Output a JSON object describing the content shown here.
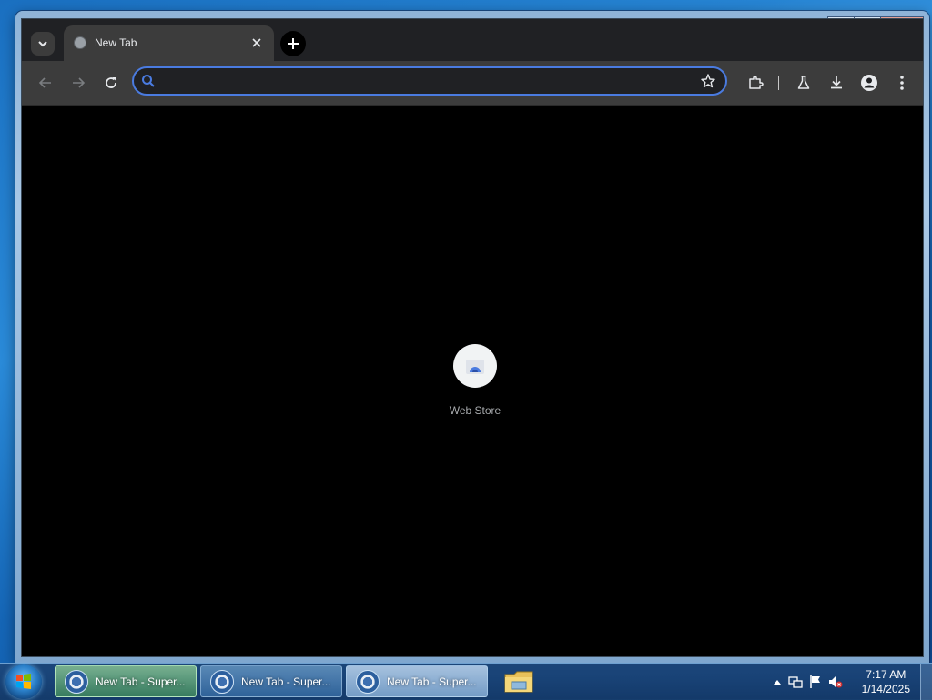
{
  "browser": {
    "tab": {
      "title": "New Tab",
      "close_icon": "close-icon"
    },
    "new_tab_icon": "plus-icon",
    "tab_search_icon": "chevron-down-icon",
    "toolbar": {
      "back_icon": "arrow-left-icon",
      "forward_icon": "arrow-right-icon",
      "reload_icon": "reload-icon",
      "omnibox": {
        "value": "",
        "placeholder": ""
      },
      "bookmark_icon": "star-icon",
      "extensions_icon": "puzzle-icon",
      "labs_icon": "flask-icon",
      "downloads_icon": "download-icon",
      "profile_icon": "person-icon",
      "menu_icon": "kebab-menu-icon"
    },
    "new_tab_page": {
      "shortcuts": [
        {
          "label": "Web Store"
        }
      ]
    },
    "accent_color": "#4a7be0",
    "background_color": "#000000"
  },
  "taskbar": {
    "items": [
      {
        "label": "New Tab - Super...",
        "state": "active"
      },
      {
        "label": "New Tab - Super...",
        "state": "normal"
      },
      {
        "label": "New Tab - Super...",
        "state": "highlight"
      }
    ],
    "clock": {
      "time": "7:17 AM",
      "date": "1/14/2025"
    }
  }
}
